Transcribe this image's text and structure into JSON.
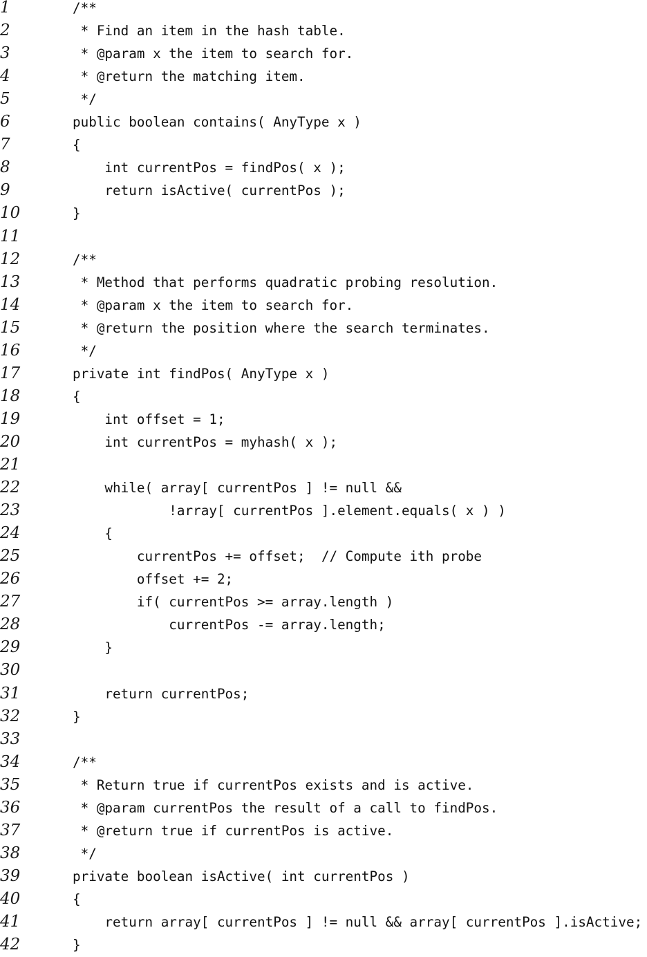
{
  "code_listing": {
    "lines": [
      {
        "number": "1",
        "text": "/**"
      },
      {
        "number": "2",
        "text": " * Find an item in the hash table."
      },
      {
        "number": "3",
        "text": " * @param x the item to search for."
      },
      {
        "number": "4",
        "text": " * @return the matching item."
      },
      {
        "number": "5",
        "text": " */"
      },
      {
        "number": "6",
        "text": "public boolean contains( AnyType x )"
      },
      {
        "number": "7",
        "text": "{"
      },
      {
        "number": "8",
        "text": "    int currentPos = findPos( x );"
      },
      {
        "number": "9",
        "text": "    return isActive( currentPos );"
      },
      {
        "number": "10",
        "text": "}"
      },
      {
        "number": "11",
        "text": ""
      },
      {
        "number": "12",
        "text": "/**"
      },
      {
        "number": "13",
        "text": " * Method that performs quadratic probing resolution."
      },
      {
        "number": "14",
        "text": " * @param x the item to search for."
      },
      {
        "number": "15",
        "text": " * @return the position where the search terminates."
      },
      {
        "number": "16",
        "text": " */"
      },
      {
        "number": "17",
        "text": "private int findPos( AnyType x )"
      },
      {
        "number": "18",
        "text": "{"
      },
      {
        "number": "19",
        "text": "    int offset = 1;"
      },
      {
        "number": "20",
        "text": "    int currentPos = myhash( x );"
      },
      {
        "number": "21",
        "text": ""
      },
      {
        "number": "22",
        "text": "    while( array[ currentPos ] != null &&"
      },
      {
        "number": "23",
        "text": "            !array[ currentPos ].element.equals( x ) )"
      },
      {
        "number": "24",
        "text": "    {"
      },
      {
        "number": "25",
        "text": "        currentPos += offset;  // Compute ith probe"
      },
      {
        "number": "26",
        "text": "        offset += 2;"
      },
      {
        "number": "27",
        "text": "        if( currentPos >= array.length )"
      },
      {
        "number": "28",
        "text": "            currentPos -= array.length;"
      },
      {
        "number": "29",
        "text": "    }"
      },
      {
        "number": "30",
        "text": ""
      },
      {
        "number": "31",
        "text": "    return currentPos;"
      },
      {
        "number": "32",
        "text": "}"
      },
      {
        "number": "33",
        "text": ""
      },
      {
        "number": "34",
        "text": "/**"
      },
      {
        "number": "35",
        "text": " * Return true if currentPos exists and is active."
      },
      {
        "number": "36",
        "text": " * @param currentPos the result of a call to findPos."
      },
      {
        "number": "37",
        "text": " * @return true if currentPos is active."
      },
      {
        "number": "38",
        "text": " */"
      },
      {
        "number": "39",
        "text": "private boolean isActive( int currentPos )"
      },
      {
        "number": "40",
        "text": "{"
      },
      {
        "number": "41",
        "text": "    return array[ currentPos ] != null && array[ currentPos ].isActive;"
      },
      {
        "number": "42",
        "text": "}"
      }
    ]
  }
}
